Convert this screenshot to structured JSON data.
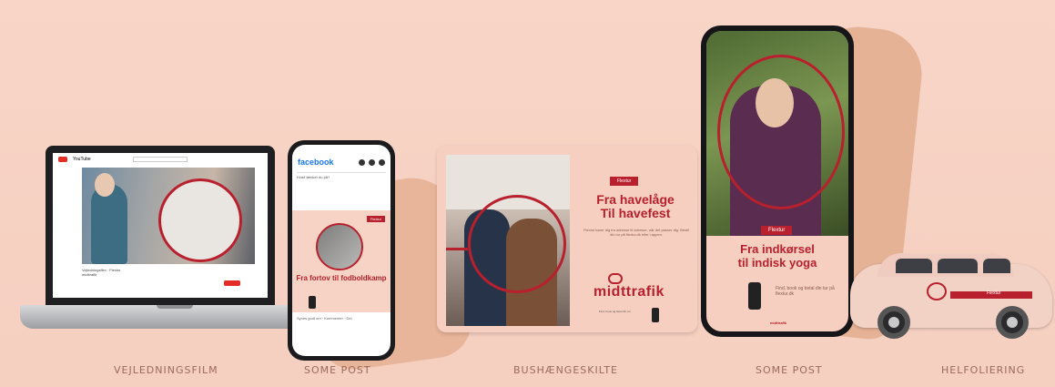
{
  "colors": {
    "background": "#f7d3c5",
    "accent": "#b8202e"
  },
  "captions": {
    "laptop": "VEJLEDNINGSFILM",
    "some1": "SOME POST",
    "bus": "BUSHÆNGESKILTE",
    "some2": "SOME POST",
    "taxi": "HELFOLIERING"
  },
  "laptop": {
    "site_label": "YouTube",
    "search_placeholder": "Søg",
    "video_meta": "Vejledningsfilm · Flextur",
    "channel": "midttrafik",
    "subscribe_label": "Abonner"
  },
  "facebook_post": {
    "brand": "facebook",
    "composer_placeholder": "Hvad tænker du på?",
    "ribbon": "Flextur",
    "headline": "Fra fortov til fodboldkamp",
    "footer": "Synes godt om · Kommenter · Del"
  },
  "bus_board": {
    "ribbon": "Flextur",
    "headline_line1": "Fra havelåge",
    "headline_line2": "Til havefest",
    "body": "Flextur kører dig fra adresse til adresse, når det passer dig. Bestil din tur på flextur.dk eller i appen.",
    "logo": "midttrafik",
    "small_print": "Find, book og betal din tur"
  },
  "story": {
    "ribbon": "Flextur",
    "headline_line1": "Fra indkørsel",
    "headline_line2": "til indisk yoga",
    "body": "Find, book og betal din tur på flextur.dk",
    "logo": "midttrafik"
  },
  "taxi": {
    "side_label": "Flextur"
  }
}
